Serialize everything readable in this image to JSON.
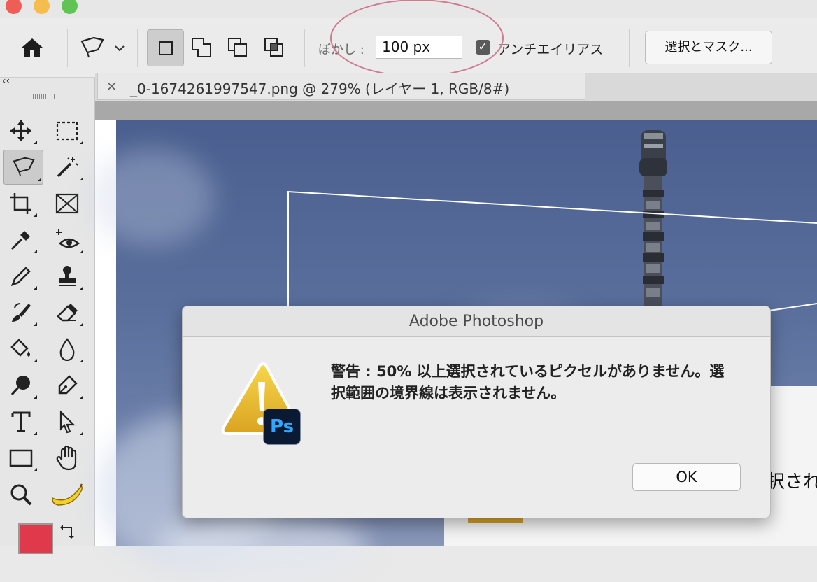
{
  "toolbar": {
    "feather_label": "ぼかし :",
    "feather_value": "100 px",
    "antialias_label": "アンチエイリアス",
    "antialias_checked": "✓",
    "select_mask_label": "選択とマスク..."
  },
  "panel": {
    "collapse_glyph": "‹‹"
  },
  "document": {
    "close_glyph": "×",
    "tab_title": "_0-1674261997547.png @ 279% (レイヤー 1, RGB/8#)"
  },
  "background_text": "択されて",
  "dialog": {
    "title": "Adobe Photoshop",
    "message": "警告 : 50% 以上選択されているピクセルがありません。選択範囲の境界線は表示されません。",
    "ok_label": "OK",
    "ps_badge": "Ps"
  },
  "colors": {
    "foreground": "#e0394c",
    "badge_bg": "#0a1a33",
    "badge_text": "#31a8ff",
    "warning": "#f2c230"
  }
}
